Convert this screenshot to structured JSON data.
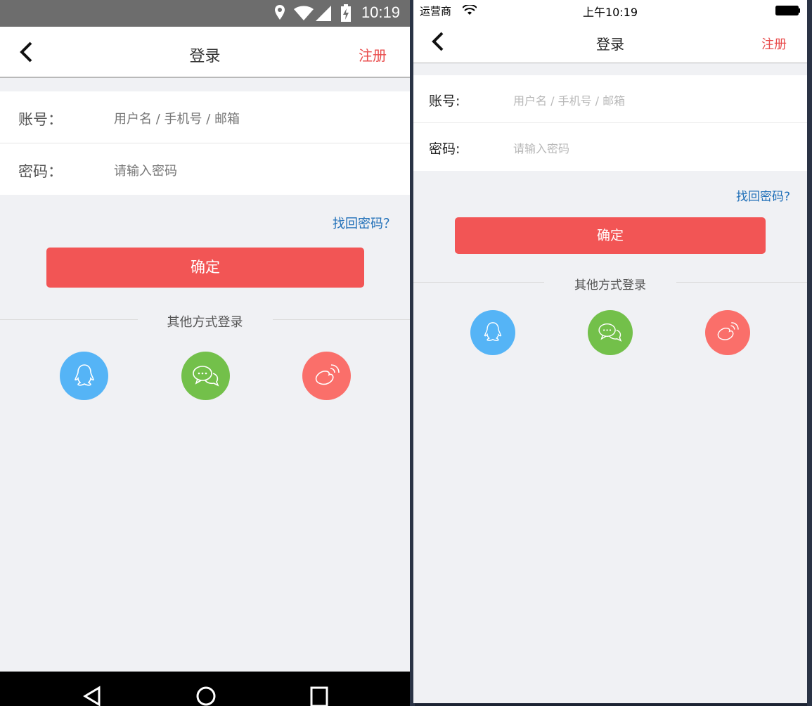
{
  "android": {
    "status": {
      "time": "10:19"
    },
    "nav": {
      "title": "登录",
      "register": "注册"
    },
    "form": {
      "account_label": "账号：",
      "account_placeholder": "用户名 / 手机号 / 邮箱",
      "password_label": "密码：",
      "password_placeholder": "请输入密码"
    },
    "forgot": "找回密码？",
    "confirm": "确定",
    "other_login": "其他方式登录",
    "social": [
      "qq-icon",
      "wechat-icon",
      "weibo-icon"
    ]
  },
  "ios": {
    "status": {
      "carrier": "运营商",
      "time": "上午10:19"
    },
    "nav": {
      "title": "登录",
      "register": "注册"
    },
    "form": {
      "account_label": "账号:",
      "account_placeholder": "用户名 / 手机号 / 邮箱",
      "password_label": "密码:",
      "password_placeholder": "请输入密码"
    },
    "forgot": "找回密码?",
    "confirm": "确定",
    "other_login": "其他方式登录",
    "social": [
      "qq-icon",
      "wechat-icon",
      "weibo-icon"
    ]
  },
  "colors": {
    "accent": "#f25555",
    "register": "#e94d4d",
    "link": "#1f6fb8",
    "qq": "#55b4f6",
    "wechat": "#73c04a",
    "weibo": "#fa6f6a"
  }
}
